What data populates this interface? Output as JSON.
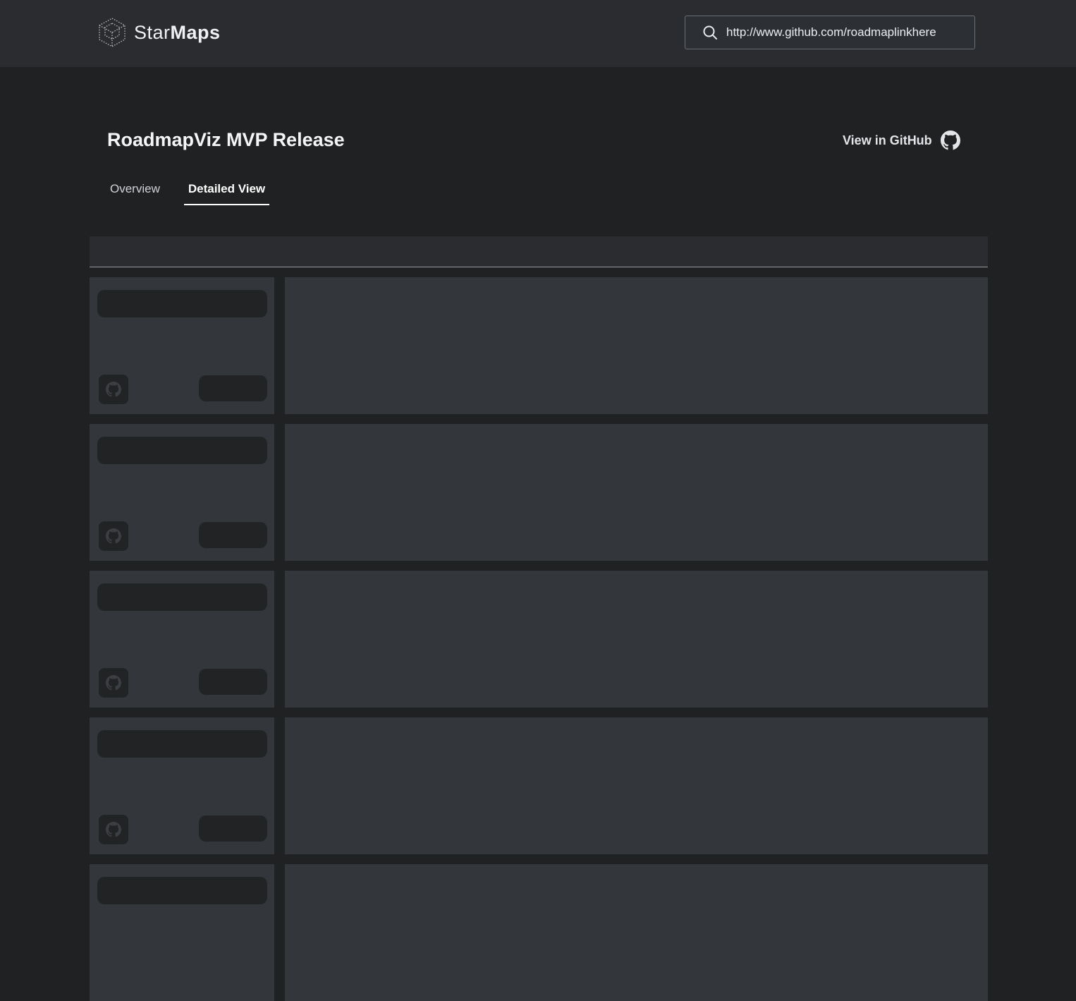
{
  "header": {
    "logo_text_light": "Star",
    "logo_text_bold": "Maps",
    "search_value": "http://www.github.com/roadmaplinkhere",
    "search_icon": "search-icon"
  },
  "page": {
    "title": "RoadmapViz MVP Release",
    "github_link_label": "View in GitHub",
    "github_icon": "github-icon"
  },
  "tabs": [
    {
      "label": "Overview",
      "active": false
    },
    {
      "label": "Detailed View",
      "active": true
    }
  ],
  "colors": {
    "background": "#202122",
    "header": "#2a2c30",
    "panel": "#33373b",
    "placeholder": "#222325"
  }
}
